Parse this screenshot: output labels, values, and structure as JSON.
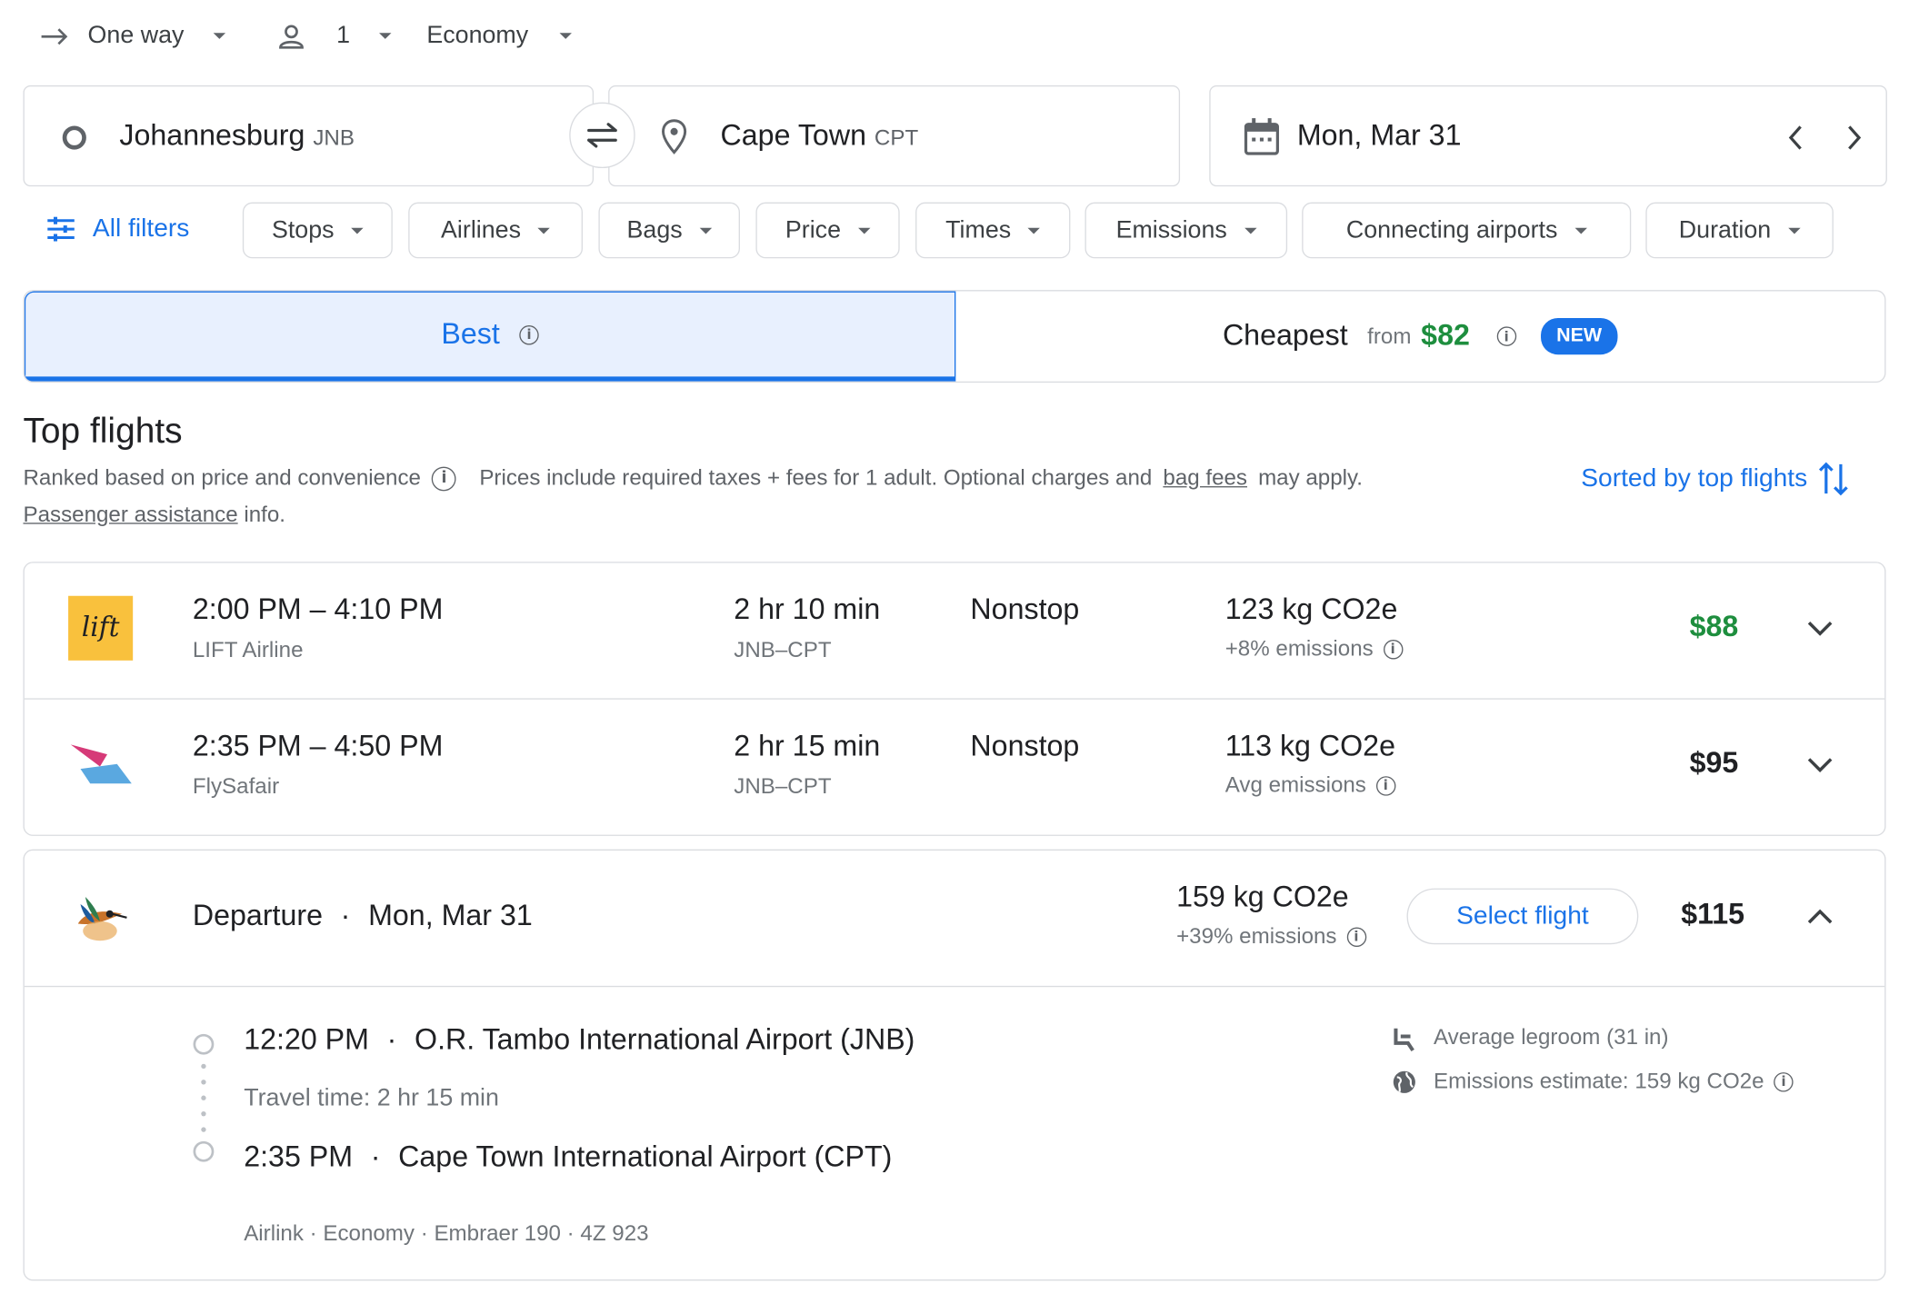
{
  "trip_options": {
    "trip_type": "One way",
    "passengers": "1",
    "cabin": "Economy"
  },
  "search": {
    "origin_city": "Johannesburg",
    "origin_code": "JNB",
    "destination_city": "Cape Town",
    "destination_code": "CPT",
    "date": "Mon, Mar 31"
  },
  "filters": {
    "all_filters": "All filters",
    "chips": [
      "Stops",
      "Airlines",
      "Bags",
      "Price",
      "Times",
      "Emissions",
      "Connecting airports",
      "Duration"
    ]
  },
  "sort_tabs": {
    "best": "Best",
    "cheapest": "Cheapest",
    "cheapest_from": "from",
    "cheapest_price": "$82",
    "new_badge": "NEW"
  },
  "results": {
    "heading": "Top flights",
    "ranked_text": "Ranked based on price and convenience",
    "prices_text_1": "Prices include required taxes + fees for 1 adult. Optional charges and",
    "bag_fees_link": "bag fees",
    "prices_text_2": "may apply.",
    "passenger_link": "Passenger assistance",
    "passenger_suffix": "info.",
    "sorted_by": "Sorted by top flights"
  },
  "flights": [
    {
      "times": "2:00 PM – 4:10 PM",
      "airline": "LIFT Airline",
      "duration": "2 hr 10 min",
      "route": "JNB–CPT",
      "stops": "Nonstop",
      "co2": "123 kg CO2e",
      "emissions_note": "+8% emissions",
      "price": "$88",
      "logo_text": "lift"
    },
    {
      "times": "2:35 PM – 4:50 PM",
      "airline": "FlySafair",
      "duration": "2 hr 15 min",
      "route": "JNB–CPT",
      "stops": "Nonstop",
      "co2": "113 kg CO2e",
      "emissions_note": "Avg emissions",
      "price": "$95"
    }
  ],
  "expanded_flight": {
    "departure_label": "Departure",
    "date": "Mon, Mar 31",
    "co2": "159 kg CO2e",
    "emissions_note": "+39% emissions",
    "select_button": "Select flight",
    "price": "$115",
    "depart_time": "12:20 PM",
    "depart_airport": "O.R. Tambo International Airport (JNB)",
    "travel_time": "Travel time: 2 hr 15 min",
    "arrive_time": "2:35 PM",
    "arrive_airport": "Cape Town International Airport (CPT)",
    "details": "Airlink · Economy · Embraer 190 · 4Z 923",
    "legroom": "Average legroom (31 in)",
    "emissions_estimate": "Emissions estimate: 159 kg CO2e"
  },
  "colors": {
    "accent_blue": "#1a73e8",
    "price_green": "#1e8e3e",
    "best_tab_bg": "#e8f0fe",
    "lift_yellow": "#f9c13d"
  }
}
